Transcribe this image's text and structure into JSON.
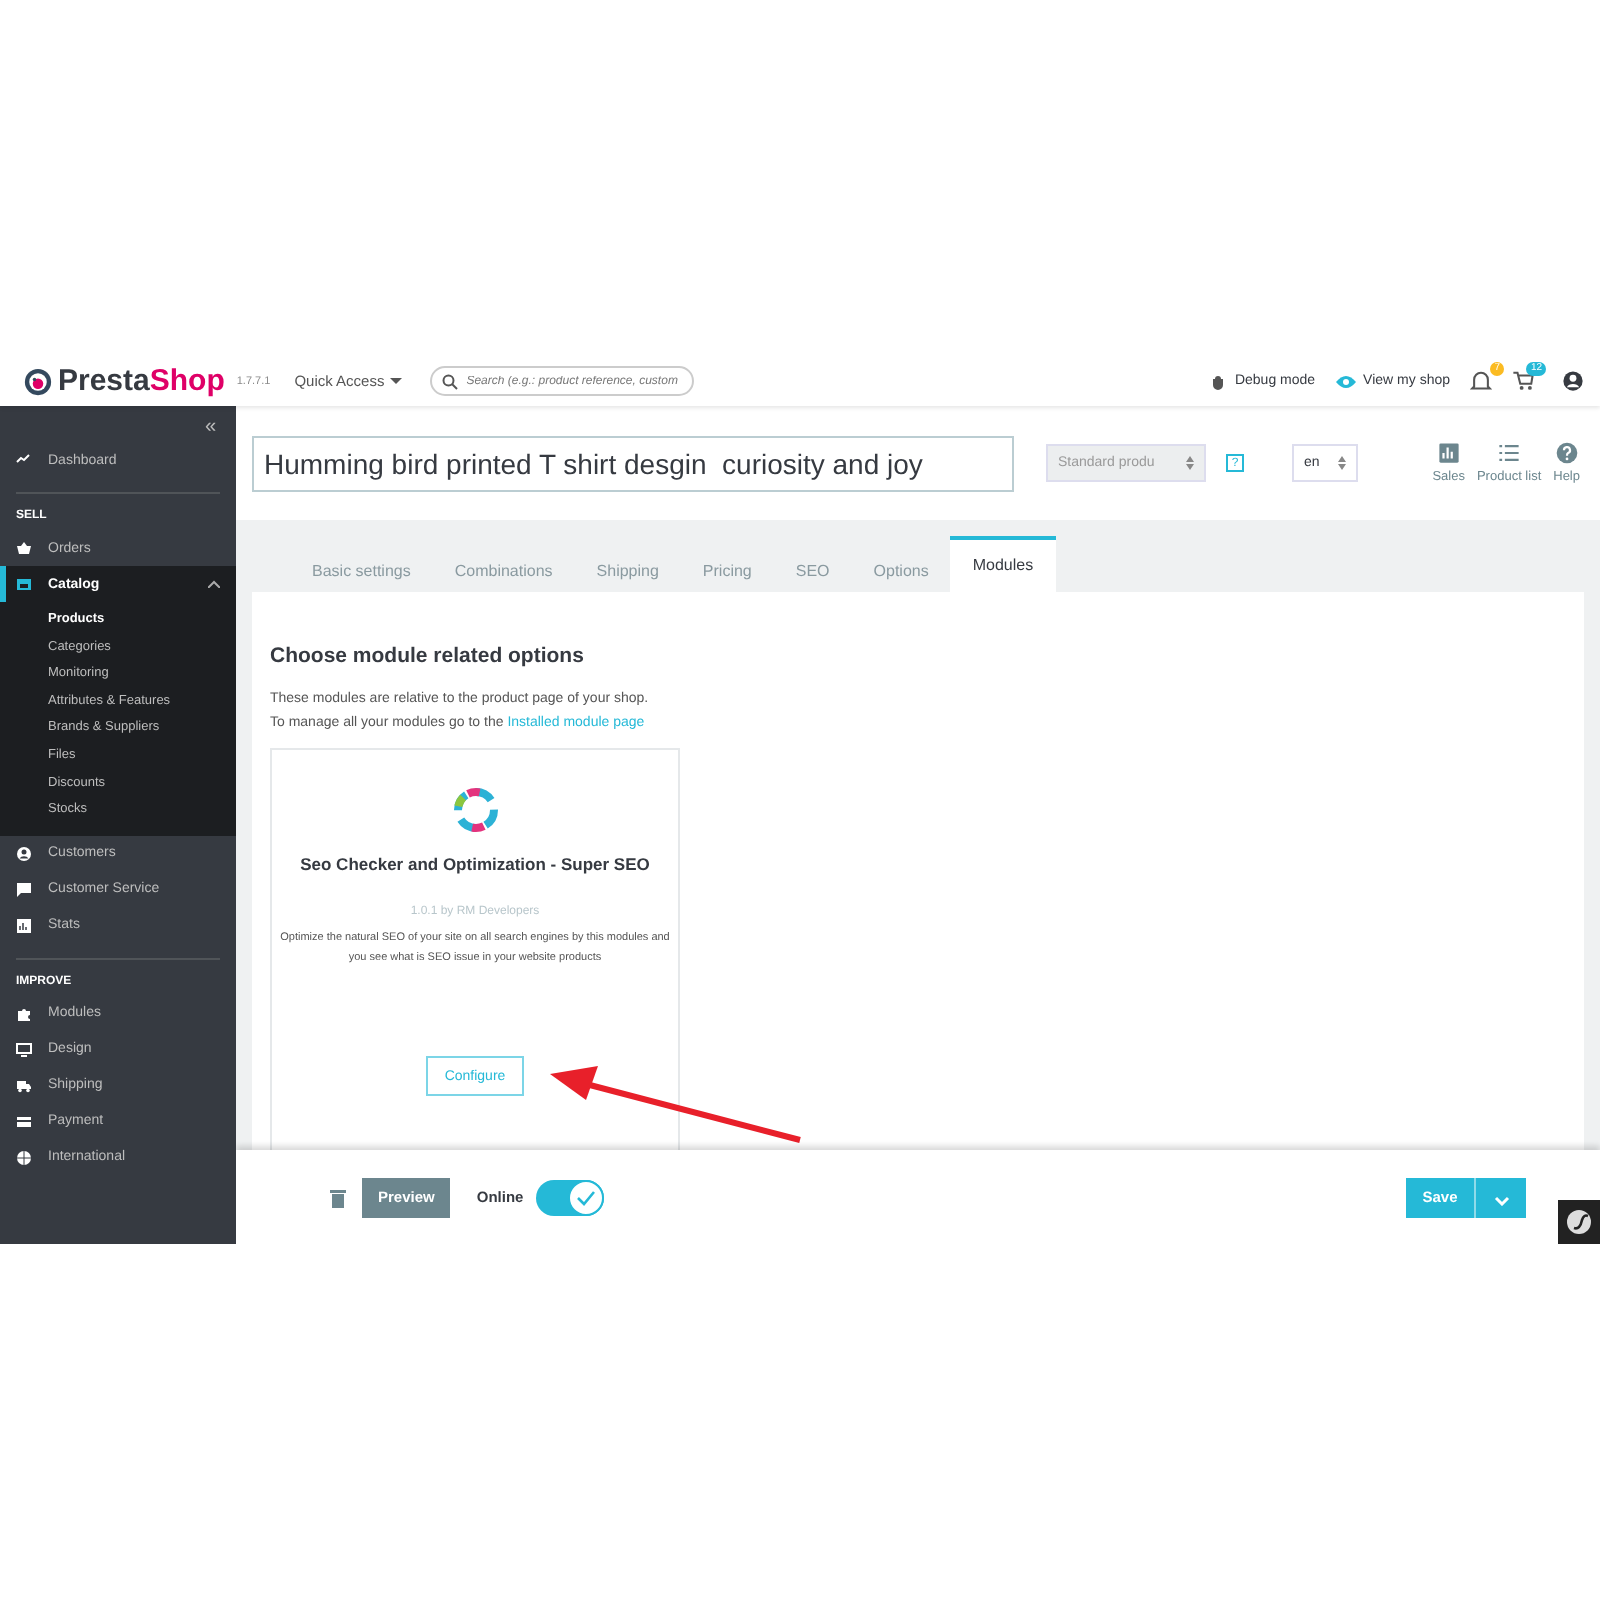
{
  "header": {
    "brand_main": "Presta",
    "brand_accent": "Shop",
    "version": "1.7.7.1",
    "quick_access": "Quick Access",
    "search": {
      "placeholder": "Search (e.g.: product reference, custom"
    },
    "debug": "Debug mode",
    "view_shop": "View my shop",
    "notifications": [
      {
        "kind": "bell",
        "count": "7"
      },
      {
        "kind": "cart",
        "count": "12"
      }
    ]
  },
  "sidebar": {
    "collapse": "«",
    "items": [
      {
        "kind": "item",
        "label": "Dashboard"
      },
      {
        "kind": "section",
        "label": "SELL"
      },
      {
        "kind": "item",
        "label": "Orders"
      },
      {
        "kind": "item",
        "label": "Catalog",
        "expanded": true,
        "children": [
          {
            "label": "Products",
            "selected": true
          },
          {
            "label": "Categories",
            "selected": false
          },
          {
            "label": "Monitoring",
            "selected": false
          },
          {
            "label": "Attributes & Features",
            "selected": false
          },
          {
            "label": "Brands & Suppliers",
            "selected": false
          },
          {
            "label": "Files",
            "selected": false
          },
          {
            "label": "Discounts",
            "selected": false
          },
          {
            "label": "Stocks",
            "selected": false
          }
        ]
      },
      {
        "kind": "item",
        "label": "Customers"
      },
      {
        "kind": "item",
        "label": "Customer Service"
      },
      {
        "kind": "item",
        "label": "Stats"
      },
      {
        "kind": "section",
        "label": "IMPROVE"
      },
      {
        "kind": "item",
        "label": "Modules"
      },
      {
        "kind": "item",
        "label": "Design"
      },
      {
        "kind": "item",
        "label": "Shipping"
      },
      {
        "kind": "item",
        "label": "Payment"
      },
      {
        "kind": "item",
        "label": "International"
      }
    ]
  },
  "toolbar": {
    "product_name": "Humming bird printed T shirt desgin  curiosity and joy",
    "product_type": "Standard produ",
    "help_mark": "?",
    "language": "en",
    "actions": [
      {
        "label": "Sales"
      },
      {
        "label": "Product list"
      },
      {
        "label": "Help"
      }
    ]
  },
  "tabs": [
    {
      "label": "Basic settings",
      "selected": false
    },
    {
      "label": "Combinations",
      "selected": false
    },
    {
      "label": "Shipping",
      "selected": false
    },
    {
      "label": "Pricing",
      "selected": false
    },
    {
      "label": "SEO",
      "selected": false
    },
    {
      "label": "Options",
      "selected": false
    },
    {
      "label": "Modules",
      "selected": true
    }
  ],
  "panel": {
    "heading": "Choose module related options",
    "intro": "These modules are relative to the product page of your shop.",
    "manage_text": "To manage all your modules go to the",
    "manage_link": "Installed module page",
    "module": {
      "name": "Seo Checker and Optimization - Super SEO",
      "version": "1.0.1 by RM Developers",
      "description": "Optimize the natural SEO of your site on all search engines by this modules and you see what is SEO issue in your website products",
      "button": "Configure"
    }
  },
  "footer": {
    "preview": "Preview",
    "online_label": "Online",
    "online": true,
    "save": "Save"
  }
}
